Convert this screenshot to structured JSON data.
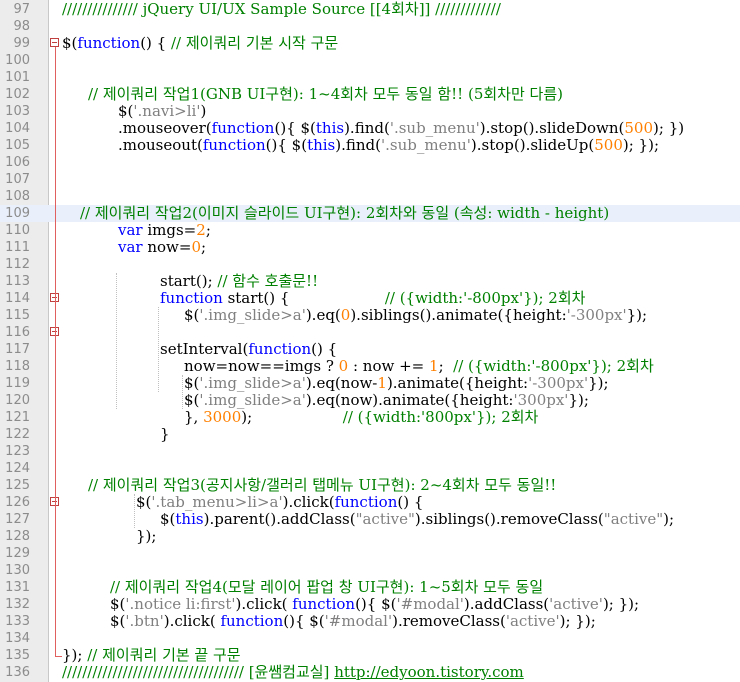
{
  "editor": {
    "lines": [
      {
        "num": "97",
        "segs": [
          {
            "t": "/////////////// jQuery UI/UX Sample Source [[4회차]] /////////////",
            "c": "c"
          }
        ]
      },
      {
        "num": "98",
        "segs": []
      },
      {
        "num": "99",
        "segs": [
          {
            "t": "$(",
            "c": ""
          },
          {
            "t": "function",
            "c": "k"
          },
          {
            "t": "() { ",
            "c": ""
          },
          {
            "t": "// 제이쿼리 기본 시작 구문",
            "c": "c"
          }
        ]
      },
      {
        "num": "100",
        "segs": []
      },
      {
        "num": "101",
        "segs": []
      },
      {
        "num": "102",
        "segs": [
          {
            "t": "// 제이쿼리 작업1(GNB UI구현): 1~4회차 모두 동일 함!! (5회차만 다름)",
            "c": "c"
          }
        ]
      },
      {
        "num": "103",
        "segs": [
          {
            "t": "$(",
            "c": ""
          },
          {
            "t": "'.navi>li'",
            "c": "s"
          },
          {
            "t": ")",
            "c": ""
          }
        ]
      },
      {
        "num": "104",
        "segs": [
          {
            "t": ".mouseover(",
            "c": ""
          },
          {
            "t": "function",
            "c": "k"
          },
          {
            "t": "(){ $(",
            "c": ""
          },
          {
            "t": "this",
            "c": "k"
          },
          {
            "t": ").find(",
            "c": ""
          },
          {
            "t": "'.sub_menu'",
            "c": "s"
          },
          {
            "t": ").stop().slideDown(",
            "c": ""
          },
          {
            "t": "500",
            "c": "n"
          },
          {
            "t": "); })",
            "c": ""
          }
        ]
      },
      {
        "num": "105",
        "segs": [
          {
            "t": ".mouseout(",
            "c": ""
          },
          {
            "t": "function",
            "c": "k"
          },
          {
            "t": "(){ $(",
            "c": ""
          },
          {
            "t": "this",
            "c": "k"
          },
          {
            "t": ").find(",
            "c": ""
          },
          {
            "t": "'.sub_menu'",
            "c": "s"
          },
          {
            "t": ").stop().slideUp(",
            "c": ""
          },
          {
            "t": "500",
            "c": "n"
          },
          {
            "t": "); });",
            "c": ""
          }
        ]
      },
      {
        "num": "106",
        "segs": []
      },
      {
        "num": "107",
        "segs": []
      },
      {
        "num": "108",
        "segs": []
      },
      {
        "num": "109",
        "segs": [
          {
            "t": "// 제이쿼리 작업2(이미지 슬라이드 UI구현): 2회차와 동일 (속성: width - height)",
            "c": "c"
          }
        ]
      },
      {
        "num": "110",
        "segs": [
          {
            "t": "var",
            "c": "k"
          },
          {
            "t": " imgs=",
            "c": ""
          },
          {
            "t": "2",
            "c": "n"
          },
          {
            "t": ";",
            "c": ""
          }
        ]
      },
      {
        "num": "111",
        "segs": [
          {
            "t": "var",
            "c": "k"
          },
          {
            "t": " now=",
            "c": ""
          },
          {
            "t": "0",
            "c": "n"
          },
          {
            "t": ";",
            "c": ""
          }
        ]
      },
      {
        "num": "112",
        "segs": []
      },
      {
        "num": "113",
        "segs": [
          {
            "t": "start(); ",
            "c": ""
          },
          {
            "t": "// 함수 호출문!!",
            "c": "c"
          }
        ]
      },
      {
        "num": "114",
        "segs": [
          {
            "t": "function",
            "c": "k"
          },
          {
            "t": " start() {                    ",
            "c": ""
          },
          {
            "t": "// ({width:'-800px'}); 2회차",
            "c": "c"
          }
        ]
      },
      {
        "num": "115",
        "segs": [
          {
            "t": "$(",
            "c": ""
          },
          {
            "t": "'.img_slide>a'",
            "c": "s"
          },
          {
            "t": ").eq(",
            "c": ""
          },
          {
            "t": "0",
            "c": "n"
          },
          {
            "t": ").siblings().animate({height:",
            "c": ""
          },
          {
            "t": "'-300px'",
            "c": "s"
          },
          {
            "t": "});",
            "c": ""
          }
        ]
      },
      {
        "num": "116",
        "segs": []
      },
      {
        "num": "117",
        "segs": [
          {
            "t": "setInterval(",
            "c": ""
          },
          {
            "t": "function",
            "c": "k"
          },
          {
            "t": "() {",
            "c": ""
          }
        ]
      },
      {
        "num": "118",
        "segs": [
          {
            "t": "now=now==imgs ? ",
            "c": ""
          },
          {
            "t": "0",
            "c": "n"
          },
          {
            "t": " : now += ",
            "c": ""
          },
          {
            "t": "1",
            "c": "n"
          },
          {
            "t": ";  ",
            "c": ""
          },
          {
            "t": "// ({width:'-800px'}); 2회차",
            "c": "c"
          }
        ]
      },
      {
        "num": "119",
        "segs": [
          {
            "t": "$(",
            "c": ""
          },
          {
            "t": "'.img_slide>a'",
            "c": "s"
          },
          {
            "t": ").eq(now-",
            "c": ""
          },
          {
            "t": "1",
            "c": "n"
          },
          {
            "t": ").animate({height:",
            "c": ""
          },
          {
            "t": "'-300px'",
            "c": "s"
          },
          {
            "t": "});",
            "c": ""
          }
        ]
      },
      {
        "num": "120",
        "segs": [
          {
            "t": "$(",
            "c": ""
          },
          {
            "t": "'.img_slide>a'",
            "c": "s"
          },
          {
            "t": ").eq(now).animate({height:",
            "c": ""
          },
          {
            "t": "'300px'",
            "c": "s"
          },
          {
            "t": "});",
            "c": ""
          }
        ]
      },
      {
        "num": "121",
        "segs": [
          {
            "t": "}, ",
            "c": ""
          },
          {
            "t": "3000",
            "c": "n"
          },
          {
            "t": ");                   ",
            "c": ""
          },
          {
            "t": "// ({width:'800px'}); 2회차",
            "c": "c"
          }
        ]
      },
      {
        "num": "122",
        "segs": [
          {
            "t": "}",
            "c": ""
          }
        ]
      },
      {
        "num": "123",
        "segs": []
      },
      {
        "num": "124",
        "segs": []
      },
      {
        "num": "125",
        "segs": [
          {
            "t": "// 제이쿼리 작업3(공지사항/갤러리 탭메뉴 UI구현): 2~4회차 모두 동일!!",
            "c": "c"
          }
        ]
      },
      {
        "num": "126",
        "segs": [
          {
            "t": "$(",
            "c": ""
          },
          {
            "t": "'.tab_menu>li>a'",
            "c": "s"
          },
          {
            "t": ").click(",
            "c": ""
          },
          {
            "t": "function",
            "c": "k"
          },
          {
            "t": "() {",
            "c": ""
          }
        ]
      },
      {
        "num": "127",
        "segs": [
          {
            "t": "$(",
            "c": ""
          },
          {
            "t": "this",
            "c": "k"
          },
          {
            "t": ").parent().addClass(",
            "c": ""
          },
          {
            "t": "\"active\"",
            "c": "s"
          },
          {
            "t": ").siblings().removeClass(",
            "c": ""
          },
          {
            "t": "\"active\"",
            "c": "s"
          },
          {
            "t": ");",
            "c": ""
          }
        ]
      },
      {
        "num": "128",
        "segs": [
          {
            "t": "});",
            "c": ""
          }
        ]
      },
      {
        "num": "129",
        "segs": []
      },
      {
        "num": "130",
        "segs": []
      },
      {
        "num": "131",
        "segs": [
          {
            "t": "// 제이쿼리 작업4(모달 레이어 팝업 창 UI구현): 1~5회차 모두 동일",
            "c": "c"
          }
        ]
      },
      {
        "num": "132",
        "segs": [
          {
            "t": "$(",
            "c": ""
          },
          {
            "t": "'.notice li:first'",
            "c": "s"
          },
          {
            "t": ").click( ",
            "c": ""
          },
          {
            "t": "function",
            "c": "k"
          },
          {
            "t": "(){ $(",
            "c": ""
          },
          {
            "t": "'#modal'",
            "c": "s"
          },
          {
            "t": ").addClass(",
            "c": ""
          },
          {
            "t": "'active'",
            "c": "s"
          },
          {
            "t": "); });",
            "c": ""
          }
        ]
      },
      {
        "num": "133",
        "segs": [
          {
            "t": "$(",
            "c": ""
          },
          {
            "t": "'.btn'",
            "c": "s"
          },
          {
            "t": ").click( ",
            "c": ""
          },
          {
            "t": "function",
            "c": "k"
          },
          {
            "t": "(){ $(",
            "c": ""
          },
          {
            "t": "'#modal'",
            "c": "s"
          },
          {
            "t": ").removeClass(",
            "c": ""
          },
          {
            "t": "'active'",
            "c": "s"
          },
          {
            "t": "); });",
            "c": ""
          }
        ]
      },
      {
        "num": "134",
        "segs": []
      },
      {
        "num": "135",
        "segs": [
          {
            "t": "}); ",
            "c": ""
          },
          {
            "t": "// 제이쿼리 기본 끝 구문",
            "c": "c"
          }
        ]
      },
      {
        "num": "136",
        "segs": [
          {
            "t": "//////////////////////////////////// [윤쌤컴교실] ",
            "c": "c"
          },
          {
            "t": "http://edyoon.tistory.com",
            "c": "u"
          }
        ]
      }
    ]
  }
}
